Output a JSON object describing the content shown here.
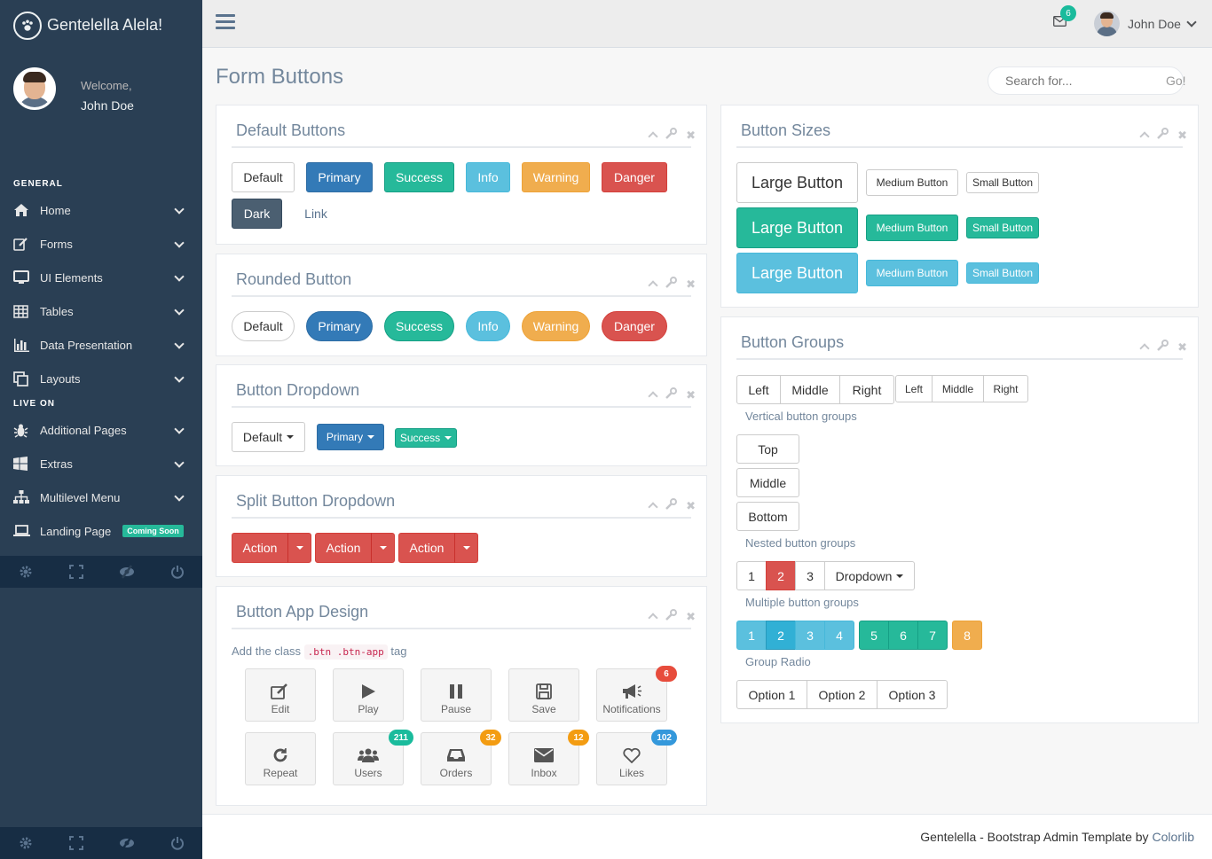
{
  "app": {
    "title": "Gentelella Alela!"
  },
  "profile": {
    "welcome": "Welcome,",
    "name": "John Doe"
  },
  "sidebar": {
    "section_general": "GENERAL",
    "section_live": "LIVE ON",
    "items": [
      {
        "label": "Home",
        "icon": "home-icon"
      },
      {
        "label": "Forms",
        "icon": "edit-icon"
      },
      {
        "label": "UI Elements",
        "icon": "desktop-icon"
      },
      {
        "label": "Tables",
        "icon": "table-icon"
      },
      {
        "label": "Data Presentation",
        "icon": "bar-chart-icon"
      },
      {
        "label": "Layouts",
        "icon": "clone-icon"
      },
      {
        "label": "Additional Pages",
        "icon": "bug-icon"
      },
      {
        "label": "Extras",
        "icon": "windows-icon"
      },
      {
        "label": "Multilevel Menu",
        "icon": "sitemap-icon"
      },
      {
        "label": "Landing Page",
        "icon": "laptop-icon",
        "badge": "Coming Soon"
      }
    ],
    "footer_icons": [
      "settings-icon",
      "fullscreen-icon",
      "eye-slash-icon",
      "power-icon"
    ]
  },
  "topnav": {
    "user_name": "John Doe",
    "mail_count": "6"
  },
  "page": {
    "title": "Form Buttons"
  },
  "search": {
    "placeholder": "Search for...",
    "go": "Go!"
  },
  "default_buttons": {
    "title": "Default Buttons",
    "buttons": [
      "Default",
      "Primary",
      "Success",
      "Info",
      "Warning",
      "Danger",
      "Dark",
      "Link"
    ]
  },
  "rounded_buttons": {
    "title": "Rounded Button",
    "buttons": [
      "Default",
      "Primary",
      "Success",
      "Info",
      "Warning",
      "Danger"
    ]
  },
  "dropdown_buttons": {
    "title": "Button Dropdown",
    "buttons": [
      "Default",
      "Primary",
      "Success"
    ]
  },
  "split_buttons": {
    "title": "Split Button Dropdown",
    "buttons": [
      "Action",
      "Action",
      "Action"
    ]
  },
  "app_design": {
    "title": "Button App Design",
    "intro": "Add the class",
    "code": ".btn .btn-app",
    "intro_suffix": "tag",
    "buttons": [
      {
        "label": "Edit"
      },
      {
        "label": "Play"
      },
      {
        "label": "Pause"
      },
      {
        "label": "Save"
      },
      {
        "label": "Notifications",
        "badge": "6"
      },
      {
        "label": "Repeat"
      },
      {
        "label": "Users",
        "badge": "211"
      },
      {
        "label": "Orders",
        "badge": "32"
      },
      {
        "label": "Inbox",
        "badge": "12"
      },
      {
        "label": "Likes",
        "badge": "102"
      }
    ]
  },
  "sizes": {
    "title": "Button Sizes",
    "large": "Large Button",
    "medium": "Medium Button",
    "small": "Small Button"
  },
  "groups": {
    "title": "Button Groups",
    "horizontal": [
      "Left",
      "Middle",
      "Right"
    ],
    "horizontal_small": [
      "Left",
      "Middle",
      "Right"
    ],
    "vertical_label": "Vertical button groups",
    "vertical": [
      "Top",
      "Middle",
      "Bottom"
    ],
    "nested_label": "Nested button groups",
    "nested": [
      "1",
      "2",
      "3",
      "Dropdown"
    ],
    "multiple_label": "Multiple button groups",
    "multiple_a": [
      "1",
      "2",
      "3",
      "4"
    ],
    "multiple_b": [
      "5",
      "6",
      "7"
    ],
    "multiple_c": [
      "8"
    ],
    "radio_label": "Group Radio",
    "radio": [
      "Option 1",
      "Option 2",
      "Option 3"
    ]
  },
  "footer": {
    "text": "Gentelella - Bootstrap Admin Template by",
    "link": "Colorlib"
  },
  "colors": {
    "sidebar": "#2a3f54",
    "primary": "#337ab7",
    "success": "#26b99a",
    "info": "#5bc0de",
    "warning": "#f0ad4e",
    "danger": "#d9534f"
  }
}
